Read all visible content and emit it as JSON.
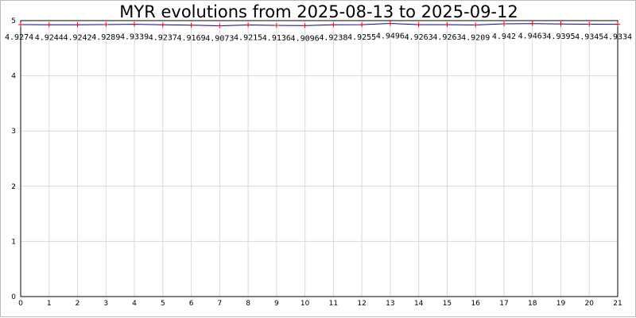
{
  "chart_data": {
    "type": "line",
    "title": "MYR evolutions from 2025-08-13 to 2025-09-12",
    "xlabel": "",
    "ylabel": "",
    "x": [
      0,
      1,
      2,
      3,
      4,
      5,
      6,
      7,
      8,
      9,
      10,
      11,
      12,
      13,
      14,
      15,
      16,
      17,
      18,
      19,
      20,
      21
    ],
    "values": [
      4.9274,
      4.9244,
      4.9242,
      4.9289,
      4.9339,
      4.9237,
      4.9169,
      4.9073,
      4.9215,
      4.9136,
      4.9096,
      4.9238,
      4.9255,
      4.9496,
      4.9263,
      4.9263,
      4.9209,
      4.942,
      4.9463,
      4.9395,
      4.9345,
      4.9334
    ],
    "data_labels": [
      "4.9274",
      "4.9244",
      "4.9242",
      "4.9289",
      "4.9339",
      "4.9237",
      "4.9169",
      "4.9073",
      "4.9215",
      "4.9136",
      "4.9096",
      "4.9238",
      "4.9255",
      "4.9496",
      "4.9263",
      "4.9263",
      "4.9209",
      "4.942",
      "4.9463",
      "4.9395",
      "4.9345",
      "4.9334"
    ],
    "xlim": [
      0,
      21
    ],
    "ylim": [
      0,
      5
    ],
    "x_ticks": [
      "0",
      "1",
      "2",
      "3",
      "4",
      "5",
      "6",
      "7",
      "8",
      "9",
      "10",
      "11",
      "12",
      "13",
      "14",
      "15",
      "16",
      "17",
      "18",
      "19",
      "20",
      "21"
    ],
    "y_ticks": [
      "0",
      "1",
      "2",
      "3",
      "4",
      "5"
    ],
    "grid": true,
    "line_color": "#0000aa",
    "marker_color": "#ff0000",
    "grid_color": "#d9d9d9"
  }
}
